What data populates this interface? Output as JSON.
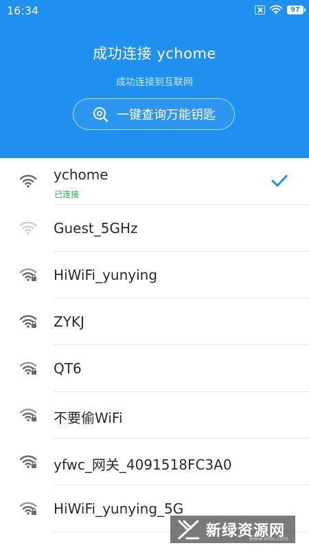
{
  "status_bar": {
    "time": "16:34",
    "battery": "97",
    "icons": [
      "no-sim-icon",
      "wifi-status-icon",
      "battery-icon"
    ]
  },
  "header": {
    "title": "成功连接 ychome",
    "subtitle": "成功连接到互联网",
    "query_button_label": "一键查询万能钥匙",
    "background_color": "#1f8ff0"
  },
  "networks": [
    {
      "ssid": "ychome",
      "status": "已连接",
      "connected": true,
      "locked": false
    },
    {
      "ssid": "Guest_5GHz",
      "connected": false,
      "locked": false
    },
    {
      "ssid": "HiWiFi_yunying",
      "connected": false,
      "locked": true
    },
    {
      "ssid": "ZYKJ",
      "connected": false,
      "locked": true
    },
    {
      "ssid": "QT6",
      "connected": false,
      "locked": true
    },
    {
      "ssid": "不要偷WiFi",
      "connected": false,
      "locked": true
    },
    {
      "ssid": "yfwc_网关_4091518FC3A0",
      "connected": false,
      "locked": true
    },
    {
      "ssid": "HiWiFi_yunying_5G",
      "connected": false,
      "locked": true
    }
  ],
  "watermark": {
    "text": "新绿资源网",
    "sub": "www.xlhs.com"
  },
  "colors": {
    "accent": "#1f8ff0",
    "connected_status": "#2bb24c",
    "check": "#1f8ff0"
  }
}
